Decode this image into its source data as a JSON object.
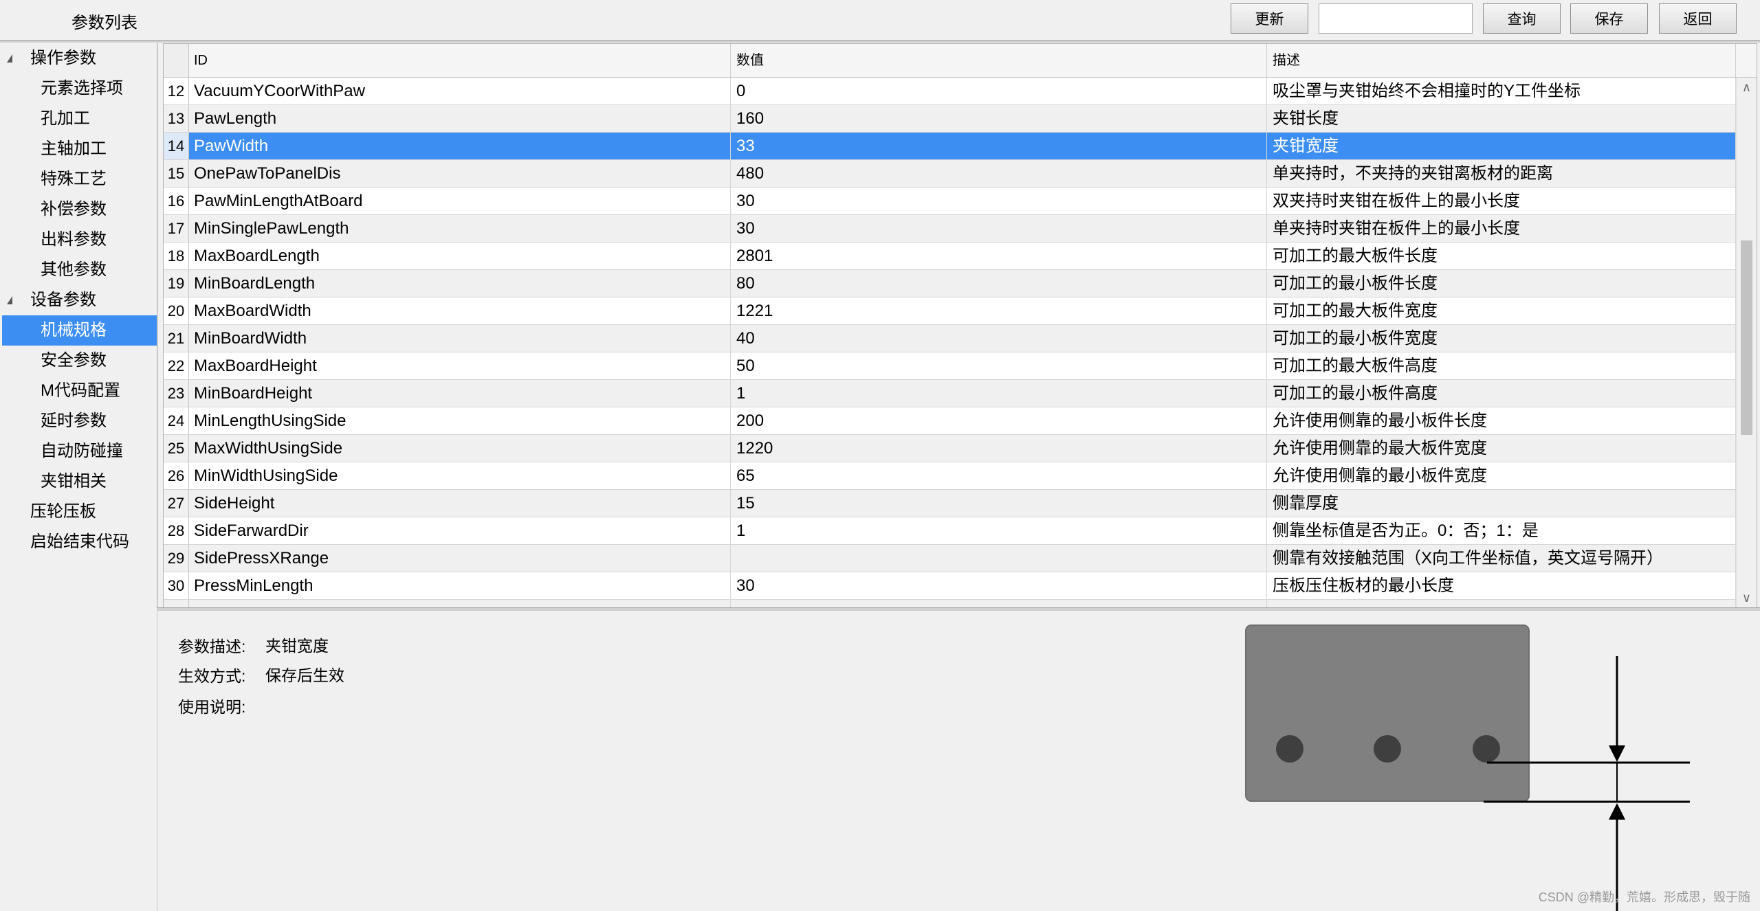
{
  "app_title": "参数列表",
  "toolbar": {
    "update_label": "更新",
    "search_value": "",
    "search_placeholder": "",
    "query_label": "查询",
    "save_label": "保存",
    "back_label": "返回"
  },
  "tree": {
    "items": [
      {
        "label": "操作参数",
        "level": 0,
        "expanded": true
      },
      {
        "label": "元素选择项",
        "level": 1
      },
      {
        "label": "孔加工",
        "level": 1
      },
      {
        "label": "主轴加工",
        "level": 1
      },
      {
        "label": "特殊工艺",
        "level": 1
      },
      {
        "label": "补偿参数",
        "level": 1
      },
      {
        "label": "出料参数",
        "level": 1
      },
      {
        "label": "其他参数",
        "level": 1
      },
      {
        "label": "设备参数",
        "level": 0,
        "expanded": true
      },
      {
        "label": "机械规格",
        "level": 1,
        "selected": true
      },
      {
        "label": "安全参数",
        "level": 1
      },
      {
        "label": "M代码配置",
        "level": 1
      },
      {
        "label": "延时参数",
        "level": 1
      },
      {
        "label": "自动防碰撞",
        "level": 1
      },
      {
        "label": "夹钳相关",
        "level": 1
      },
      {
        "label": "压轮压板",
        "level": 0
      },
      {
        "label": "启始结束代码",
        "level": 0
      }
    ]
  },
  "grid": {
    "columns": [
      "ID",
      "数值",
      "描述"
    ],
    "selected_row": "14",
    "rows": [
      {
        "num": "12",
        "id": "VacuumYCoorWithPaw",
        "value": "0",
        "desc": "吸尘罩与夹钳始终不会相撞时的Y工件坐标"
      },
      {
        "num": "13",
        "id": "PawLength",
        "value": "160",
        "desc": "夹钳长度"
      },
      {
        "num": "14",
        "id": "PawWidth",
        "value": "33",
        "desc": "夹钳宽度"
      },
      {
        "num": "15",
        "id": "OnePawToPanelDis",
        "value": "480",
        "desc": "单夹持时，不夹持的夹钳离板材的距离"
      },
      {
        "num": "16",
        "id": "PawMinLengthAtBoard",
        "value": "30",
        "desc": "双夹持时夹钳在板件上的最小长度"
      },
      {
        "num": "17",
        "id": "MinSinglePawLength",
        "value": "30",
        "desc": "单夹持时夹钳在板件上的最小长度"
      },
      {
        "num": "18",
        "id": "MaxBoardLength",
        "value": "2801",
        "desc": "可加工的最大板件长度"
      },
      {
        "num": "19",
        "id": "MinBoardLength",
        "value": "80",
        "desc": "可加工的最小板件长度"
      },
      {
        "num": "20",
        "id": "MaxBoardWidth",
        "value": "1221",
        "desc": "可加工的最大板件宽度"
      },
      {
        "num": "21",
        "id": "MinBoardWidth",
        "value": "40",
        "desc": "可加工的最小板件宽度"
      },
      {
        "num": "22",
        "id": "MaxBoardHeight",
        "value": "50",
        "desc": "可加工的最大板件高度"
      },
      {
        "num": "23",
        "id": "MinBoardHeight",
        "value": "1",
        "desc": "可加工的最小板件高度"
      },
      {
        "num": "24",
        "id": "MinLengthUsingSide",
        "value": "200",
        "desc": "允许使用侧靠的最小板件长度"
      },
      {
        "num": "25",
        "id": "MaxWidthUsingSide",
        "value": "1220",
        "desc": "允许使用侧靠的最大板件宽度"
      },
      {
        "num": "26",
        "id": "MinWidthUsingSide",
        "value": "65",
        "desc": "允许使用侧靠的最小板件宽度"
      },
      {
        "num": "27",
        "id": "SideHeight",
        "value": "15",
        "desc": "侧靠厚度"
      },
      {
        "num": "28",
        "id": "SideFarwardDir",
        "value": "1",
        "desc": "侧靠坐标值是否为正。0：否；1：是"
      },
      {
        "num": "29",
        "id": "SidePressXRange",
        "value": "",
        "desc": "侧靠有效接触范围（X向工件坐标值，英文逗号隔开）"
      },
      {
        "num": "30",
        "id": "PressMinLength",
        "value": "30",
        "desc": "压板压住板材的最小长度"
      },
      {
        "num": "",
        "id": "",
        "value": "",
        "desc": ""
      }
    ]
  },
  "detail": {
    "desc_label": "参数描述:",
    "desc_value": "夹钳宽度",
    "effect_label": "生效方式:",
    "effect_value": "保存后生效",
    "usage_label": "使用说明:",
    "usage_value": ""
  },
  "watermark": "CSDN @精勤，荒嬉。形成思，毁于随",
  "colors": {
    "selection": "#3d8ef3",
    "diagram_panel": "#808080",
    "diagram_hole": "#3f3f3f"
  }
}
